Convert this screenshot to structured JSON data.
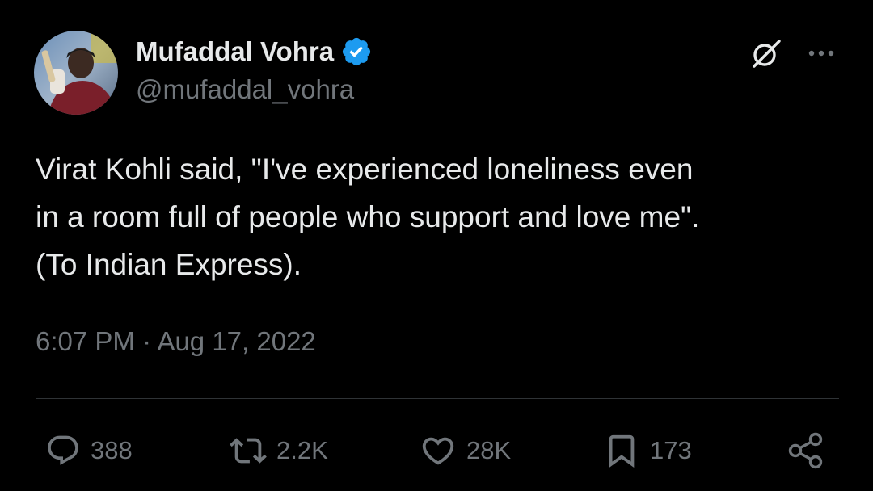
{
  "author": {
    "display_name": "Mufaddal Vohra",
    "handle": "@mufaddal_vohra",
    "verified": true,
    "verified_color": "#1d9bf0",
    "avatar_icon": "profile-photo"
  },
  "tweet": {
    "text": "Virat Kohli said, \"I've experienced loneliness even\nin a room full of people who support and love me\".\n(To Indian Express).",
    "time": "6:07 PM",
    "separator": "·",
    "date": "Aug 17, 2022"
  },
  "top_actions": {
    "grok_icon": "grok-icon",
    "more_icon": "more-icon"
  },
  "actions": {
    "replies": "388",
    "reposts": "2.2K",
    "likes": "28K",
    "bookmarks": "173",
    "share_icon": "share-icon"
  },
  "colors": {
    "background": "#000000",
    "text": "#e7e9ea",
    "secondary": "#71767b",
    "divider": "#2f3336"
  }
}
